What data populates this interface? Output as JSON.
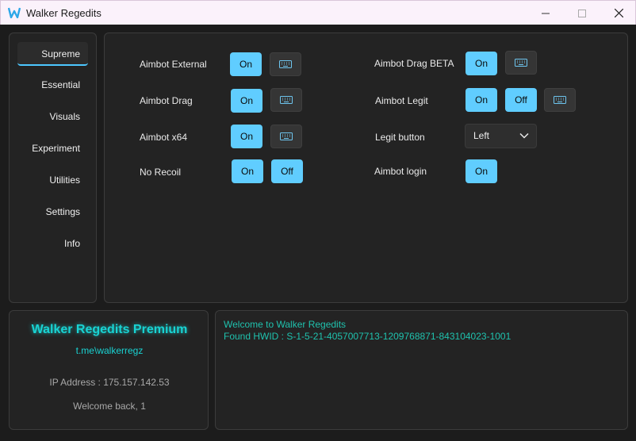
{
  "window": {
    "title": "Walker Regedits",
    "accent": "#60cdff"
  },
  "sidebar": {
    "items": [
      {
        "label": "Supreme"
      },
      {
        "label": "Essential"
      },
      {
        "label": "Visuals"
      },
      {
        "label": "Experiment"
      },
      {
        "label": "Utilities"
      },
      {
        "label": "Settings"
      },
      {
        "label": "Info"
      }
    ]
  },
  "main": {
    "left": [
      {
        "label": "Aimbot External",
        "on": "On"
      },
      {
        "label": "Aimbot Drag",
        "on": "On"
      },
      {
        "label": "Aimbot x64",
        "on": "On"
      },
      {
        "label": "No Recoil",
        "on": "On",
        "off": "Off"
      }
    ],
    "right": [
      {
        "label": "Aimbot Drag BETA",
        "on": "On"
      },
      {
        "label": "Aimbot Legit",
        "on": "On",
        "off": "Off"
      },
      {
        "label": "Legit button",
        "select": "Left"
      },
      {
        "label": "Aimbot login",
        "on": "On"
      }
    ]
  },
  "info": {
    "brand": "Walker Regedits Premium",
    "link": "t.me\\walkerregz",
    "ip": "IP Address : 175.157.142.53",
    "welcome": "Welcome back, 1"
  },
  "console": {
    "lines": [
      "Welcome to Walker Regedits",
      "Found HWID : S-1-5-21-4057007713-1209768871-843104023-1001"
    ]
  }
}
